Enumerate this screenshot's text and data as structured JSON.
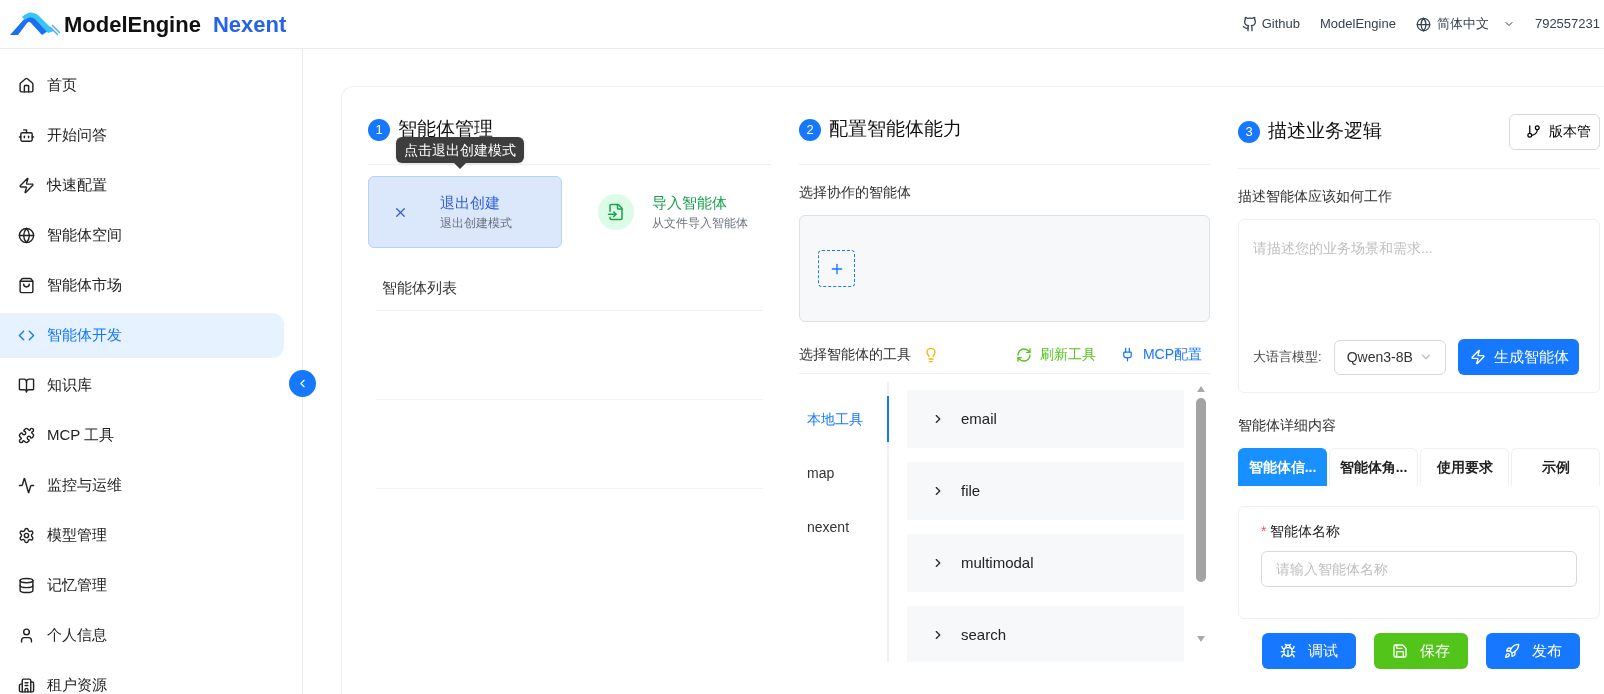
{
  "header": {
    "brand": "ModelEngine",
    "product": "Nexent",
    "links": [
      {
        "kind": "github",
        "label": "Github"
      },
      {
        "kind": "plain",
        "label": "ModelEngine"
      }
    ],
    "language": "简体中文",
    "user": "792557231"
  },
  "sidebar": {
    "items": [
      {
        "label": "首页",
        "selected": false
      },
      {
        "label": "开始问答",
        "selected": false
      },
      {
        "label": "快速配置",
        "selected": false
      },
      {
        "label": "智能体空间",
        "selected": false
      },
      {
        "label": "智能体市场",
        "selected": false
      },
      {
        "label": "智能体开发",
        "selected": true
      },
      {
        "label": "知识库",
        "selected": false
      },
      {
        "label": "MCP 工具",
        "selected": false
      },
      {
        "label": "监控与运维",
        "selected": false
      },
      {
        "label": "模型管理",
        "selected": false
      },
      {
        "label": "记忆管理",
        "selected": false
      },
      {
        "label": "个人信息",
        "selected": false
      },
      {
        "label": "租户资源",
        "selected": false
      }
    ]
  },
  "agent_management": {
    "step": "1",
    "title": "智能体管理",
    "tooltip": "点击退出创建模式",
    "actions": [
      {
        "kind": "exit",
        "title": "退出创建",
        "subtitle": "退出创建模式"
      },
      {
        "kind": "import",
        "title": "导入智能体",
        "subtitle": "从文件导入智能体"
      }
    ],
    "list_title": "智能体列表"
  },
  "capabilities": {
    "step": "2",
    "title": "配置智能体能力",
    "collab_label": "选择协作的智能体",
    "tools_label": "选择智能体的工具",
    "refresh": "刷新工具",
    "mcp": "MCP配置",
    "categories": [
      {
        "label": "本地工具",
        "selected": true
      },
      {
        "label": "map",
        "selected": false
      },
      {
        "label": "nexent",
        "selected": false
      }
    ],
    "tools": [
      {
        "name": "email",
        "expanded": false
      },
      {
        "name": "file",
        "expanded": false
      },
      {
        "name": "multimodal",
        "expanded": false
      },
      {
        "name": "search",
        "expanded": false
      }
    ]
  },
  "business_logic": {
    "step": "3",
    "title": "描述业务逻辑",
    "version_button": "版本管",
    "describe_label": "描述智能体应该如何工作",
    "placeholder": "请描述您的业务场景和需求...",
    "model_label": "大语言模型:",
    "model": "Qwen3-8B",
    "generate": "生成智能体",
    "details_title": "智能体详细内容",
    "tabs": [
      {
        "label": "智能体信...",
        "selected": true
      },
      {
        "label": "智能体角...",
        "selected": false
      },
      {
        "label": "使用要求",
        "selected": false
      },
      {
        "label": "示例",
        "selected": false
      }
    ],
    "name_label": "智能体名称",
    "name_required_mark": "*",
    "name_placeholder": "请输入智能体名称",
    "buttons": [
      {
        "kind": "debug",
        "label": "调试"
      },
      {
        "kind": "save",
        "label": "保存"
      },
      {
        "kind": "publish",
        "label": "发布"
      }
    ]
  }
}
